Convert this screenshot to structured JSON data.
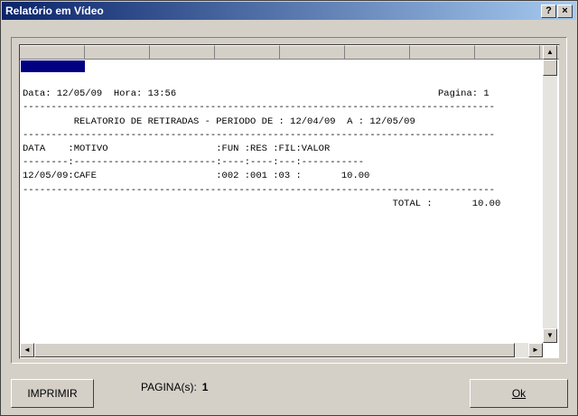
{
  "window": {
    "title": "Relatório em Vídeo",
    "help_glyph": "?",
    "close_glyph": "×"
  },
  "report_lines": [
    "Data: 12/05/09  Hora: 13:56                                              Pagina: 1",
    "-----------------------------------------------------------------------------------",
    "         RELATORIO DE RETIRADAS - PERIODO DE : 12/04/09  A : 12/05/09",
    "-----------------------------------------------------------------------------------",
    "DATA    :MOTIVO                   :FUN :RES :FIL:VALOR",
    "--------:-------------------------:----:----:---:-----------",
    "12/05/09:CAFE                     :002 :001 :03 :       10.00",
    "-----------------------------------------------------------------------------------",
    "                                                                 TOTAL :       10.00"
  ],
  "footer": {
    "print_label": "IMPRIMIR",
    "pages_label": "PAGINA(s):",
    "pages_value": "1",
    "ok_label": "Ok"
  },
  "scroll": {
    "up": "▲",
    "down": "▼",
    "left": "◄",
    "right": "►"
  }
}
